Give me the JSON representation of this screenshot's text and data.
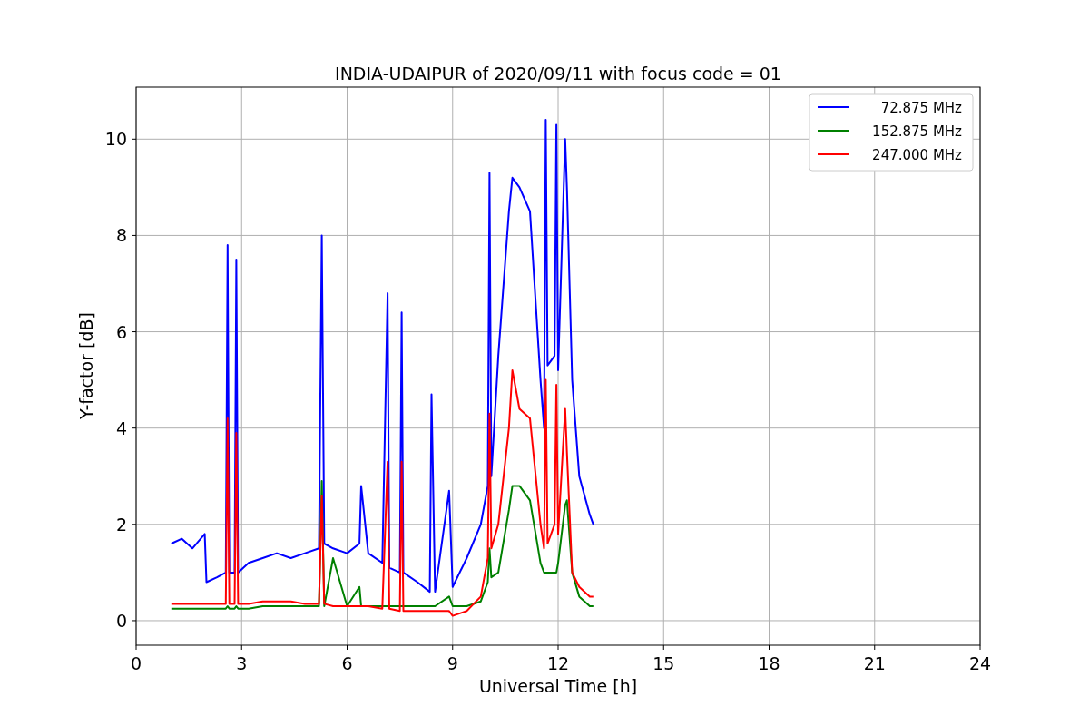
{
  "figure": {
    "chart_data": {
      "type": "line",
      "title": "INDIA-UDAIPUR of 2020/09/11 with focus code = 01",
      "xlabel": "Universal Time [h]",
      "ylabel": "Y-factor [dB]",
      "x": [
        1.0,
        1.3,
        1.6,
        1.95,
        2.0,
        2.3,
        2.55,
        2.6,
        2.65,
        2.8,
        2.85,
        2.9,
        3.2,
        3.6,
        4.0,
        4.4,
        4.8,
        5.2,
        5.28,
        5.35,
        5.6,
        6.0,
        6.35,
        6.4,
        6.6,
        7.0,
        7.15,
        7.2,
        7.5,
        7.55,
        7.6,
        8.0,
        8.35,
        8.4,
        8.5,
        8.9,
        9.0,
        9.4,
        9.8,
        10.0,
        10.05,
        10.1,
        10.3,
        10.6,
        10.7,
        10.9,
        11.2,
        11.5,
        11.6,
        11.65,
        11.7,
        11.9,
        11.95,
        12.0,
        12.2,
        12.25,
        12.4,
        12.6,
        12.9,
        13.0
      ],
      "series": [
        {
          "name": "72.875 MHz",
          "color": "#0000ff",
          "values": [
            1.6,
            1.7,
            1.5,
            1.8,
            0.8,
            0.9,
            1.0,
            7.8,
            1.0,
            1.0,
            7.5,
            1.0,
            1.2,
            1.3,
            1.4,
            1.3,
            1.4,
            1.5,
            8.0,
            1.6,
            1.5,
            1.4,
            1.6,
            2.8,
            1.4,
            1.2,
            6.8,
            1.1,
            1.0,
            6.4,
            1.0,
            0.8,
            0.6,
            4.7,
            0.6,
            2.7,
            0.7,
            1.3,
            2.0,
            2.8,
            9.3,
            3.0,
            5.5,
            8.5,
            9.2,
            9.0,
            8.5,
            5.0,
            4.0,
            10.4,
            5.3,
            5.5,
            10.3,
            5.2,
            10.0,
            9.0,
            5.0,
            3.0,
            2.2,
            2.0
          ]
        },
        {
          "name": "152.875 MHz",
          "color": "#008000",
          "values": [
            0.25,
            0.25,
            0.25,
            0.25,
            0.25,
            0.25,
            0.25,
            0.3,
            0.25,
            0.25,
            0.3,
            0.25,
            0.25,
            0.3,
            0.3,
            0.3,
            0.3,
            0.3,
            2.9,
            0.3,
            1.3,
            0.3,
            0.7,
            0.3,
            0.3,
            0.3,
            0.3,
            0.3,
            0.3,
            0.3,
            0.3,
            0.3,
            0.3,
            0.3,
            0.3,
            0.5,
            0.3,
            0.3,
            0.4,
            0.8,
            1.5,
            0.9,
            1.0,
            2.3,
            2.8,
            2.8,
            2.5,
            1.2,
            1.0,
            1.0,
            1.0,
            1.0,
            1.0,
            1.2,
            2.4,
            2.5,
            1.0,
            0.5,
            0.3,
            0.3
          ]
        },
        {
          "name": "247.000 MHz",
          "color": "#ff0000",
          "values": [
            0.35,
            0.35,
            0.35,
            0.35,
            0.35,
            0.35,
            0.35,
            4.2,
            0.35,
            0.35,
            3.9,
            0.35,
            0.35,
            0.4,
            0.4,
            0.4,
            0.35,
            0.35,
            2.6,
            0.35,
            0.3,
            0.3,
            0.3,
            0.3,
            0.3,
            0.25,
            3.3,
            0.25,
            0.2,
            3.3,
            0.2,
            0.2,
            0.2,
            0.2,
            0.2,
            0.2,
            0.1,
            0.2,
            0.5,
            1.3,
            4.3,
            1.5,
            2.0,
            4.0,
            5.2,
            4.4,
            4.2,
            2.0,
            1.5,
            5.0,
            1.6,
            2.0,
            4.9,
            1.8,
            4.4,
            3.5,
            1.0,
            0.7,
            0.5,
            0.5
          ]
        }
      ],
      "grid": true,
      "legend": true,
      "xlim": [
        0,
        24
      ],
      "ylim": [
        -0.51,
        11.08
      ],
      "xticks": [
        0,
        3,
        6,
        9,
        12,
        15,
        18,
        21,
        24
      ],
      "yticks": [
        0,
        2,
        4,
        6,
        8,
        10
      ]
    }
  }
}
